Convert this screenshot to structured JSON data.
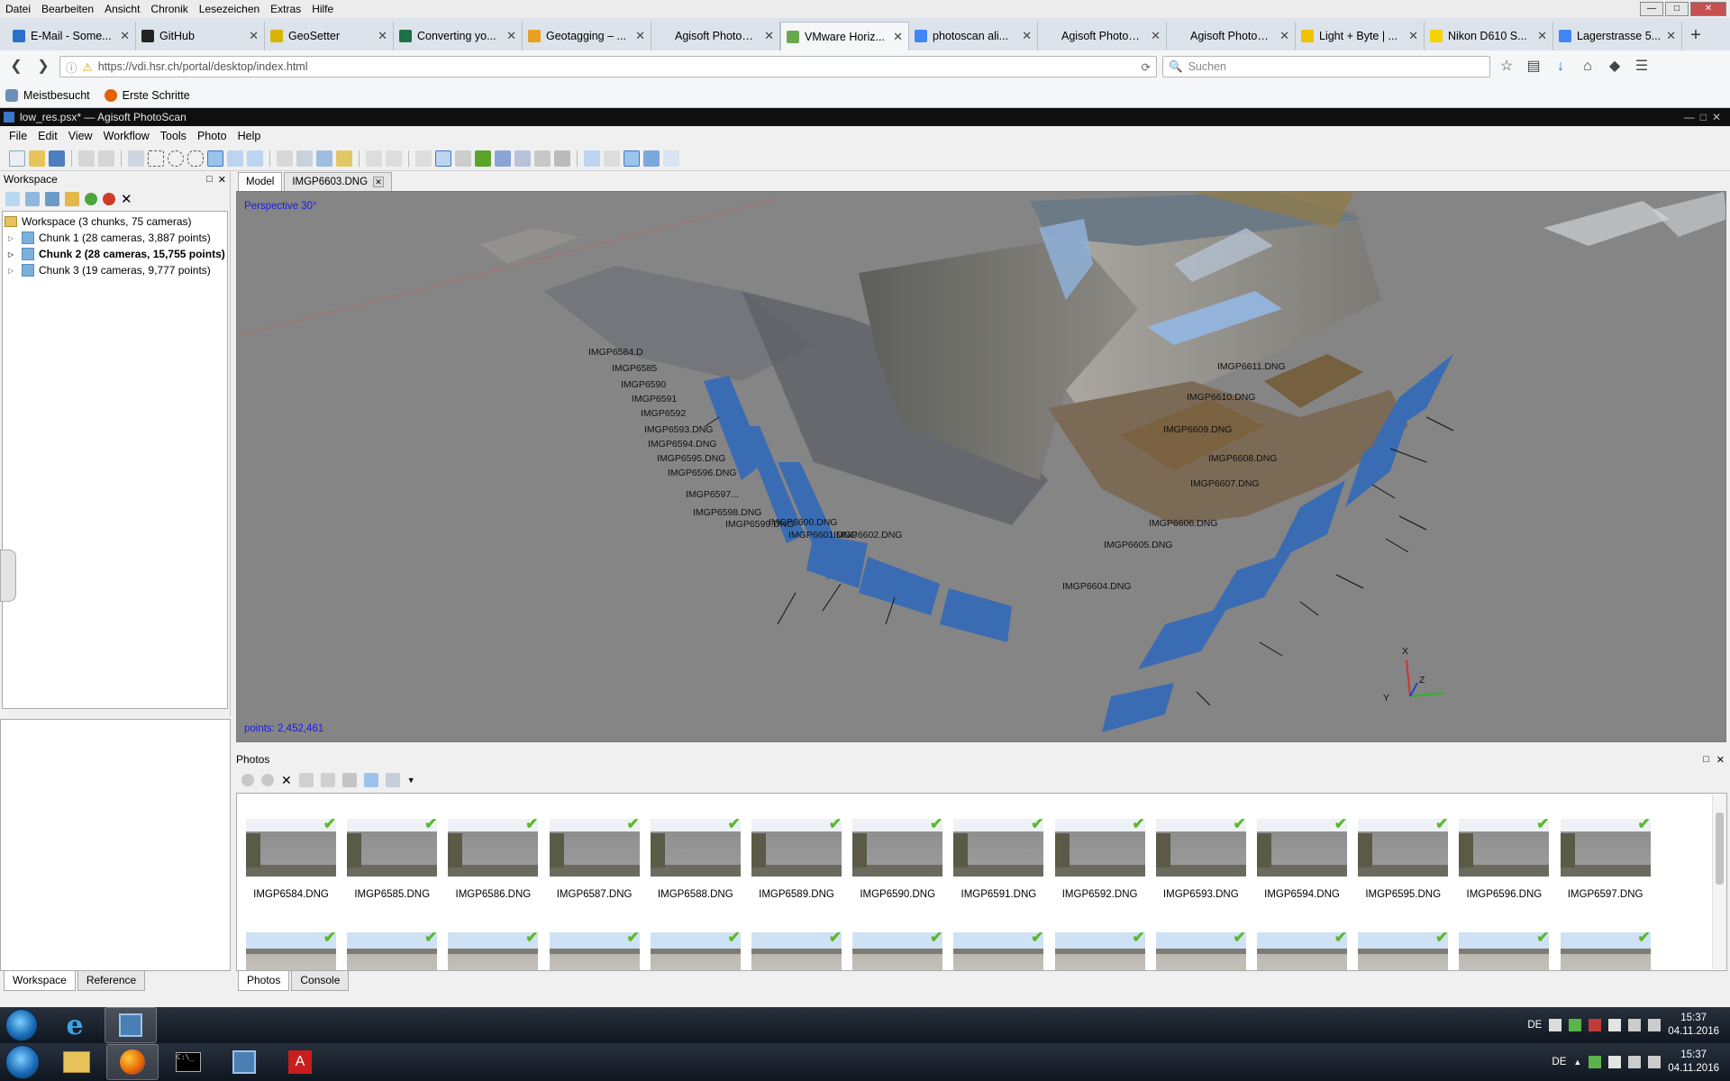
{
  "firefox": {
    "menu": [
      "Datei",
      "Bearbeiten",
      "Ansicht",
      "Chronik",
      "Lesezeichen",
      "Extras",
      "Hilfe"
    ],
    "tabs": [
      {
        "label": "E-Mail - Some...",
        "icon": "mail-icon",
        "color": "#2a6fc9",
        "active": false
      },
      {
        "label": "GitHub",
        "icon": "github-icon",
        "color": "#222222",
        "active": false
      },
      {
        "label": "GeoSetter",
        "icon": "geosetter-icon",
        "color": "#d8b400",
        "active": false
      },
      {
        "label": "Converting yo...",
        "icon": "excel-icon",
        "color": "#1e7145",
        "active": false
      },
      {
        "label": "Geotagging – ...",
        "icon": "geotag-icon",
        "color": "#e8a020",
        "active": false
      },
      {
        "label": "Agisoft PhotoSca...",
        "icon": "",
        "color": "",
        "active": false
      },
      {
        "label": "VMware Horiz...",
        "icon": "vmware-icon",
        "color": "#6aa84f",
        "active": true
      },
      {
        "label": "photoscan ali...",
        "icon": "google-icon",
        "color": "#4285f4",
        "active": false
      },
      {
        "label": "Agisoft PhotoSca...",
        "icon": "",
        "color": "",
        "active": false
      },
      {
        "label": "Agisoft PhotoSca...",
        "icon": "",
        "color": "",
        "active": false
      },
      {
        "label": "Light + Byte | ...",
        "icon": "lightbyte-icon",
        "color": "#f2c200",
        "active": false
      },
      {
        "label": "Nikon D610 S...",
        "icon": "nikon-icon",
        "color": "#f5d300",
        "active": false
      },
      {
        "label": "Lagerstrasse 5...",
        "icon": "google-icon",
        "color": "#4285f4",
        "active": false
      }
    ],
    "url": "https://vdi.hsr.ch/portal/desktop/index.html",
    "search_placeholder": "Suchen",
    "bookmarks": [
      "Meistbesucht",
      "Erste Schritte"
    ]
  },
  "photoscan": {
    "title": "low_res.psx* — Agisoft PhotoScan",
    "menu": [
      "File",
      "Edit",
      "View",
      "Workflow",
      "Tools",
      "Photo",
      "Help"
    ],
    "workspace": {
      "header": "Workspace",
      "root": "Workspace (3 chunks, 75 cameras)",
      "chunks": [
        {
          "label": "Chunk 1 (28 cameras, 3,887 points)",
          "active": false
        },
        {
          "label": "Chunk 2 (28 cameras, 15,755 points)",
          "active": true
        },
        {
          "label": "Chunk 3 (19 cameras, 9,777 points)",
          "active": false
        }
      ],
      "bottom_tabs": [
        "Workspace",
        "Reference"
      ]
    },
    "view_tabs": [
      "Model",
      "IMGP6603.DNG"
    ],
    "viewport": {
      "projection": "Perspective 30°",
      "points": "points: 2,452,461",
      "axis_labels": [
        "X",
        "Y",
        "Z"
      ],
      "camera_labels": [
        "IMGP6584.D",
        "IMGP6585",
        "IMGP6590",
        "IMGP6591",
        "IMGP6592",
        "IMGP6593.DNG",
        "IMGP6594.DNG",
        "IMGP6595.DNG",
        "IMGP6596.DNG",
        "IMGP6597...",
        "IMGP6598.DNG",
        "IMGP6599.DNG",
        "IMGP6600.DNG",
        "IMGP6601.DNG",
        "IMGP6602.DNG",
        "IMGP6611.DNG",
        "IMGP6610.DNG",
        "IMGP6609.DNG",
        "IMGP6608.DNG",
        "IMGP6607.DNG",
        "IMGP6606.DNG",
        "IMGP6605.DNG",
        "IMGP6604.DNG"
      ]
    },
    "photos": {
      "header": "Photos",
      "thumbnails": [
        "IMGP6584.DNG",
        "IMGP6585.DNG",
        "IMGP6586.DNG",
        "IMGP6587.DNG",
        "IMGP6588.DNG",
        "IMGP6589.DNG",
        "IMGP6590.DNG",
        "IMGP6591.DNG",
        "IMGP6592.DNG",
        "IMGP6593.DNG",
        "IMGP6594.DNG",
        "IMGP6595.DNG",
        "IMGP6596.DNG",
        "IMGP6597.DNG"
      ],
      "bottom_tabs": [
        "Photos",
        "Console"
      ]
    }
  },
  "taskbar_vdi": {
    "lang": "DE",
    "time": "15:37",
    "date": "04.11.2016"
  },
  "taskbar_host": {
    "lang": "DE",
    "time": "15:37",
    "date": "04.11.2016"
  }
}
